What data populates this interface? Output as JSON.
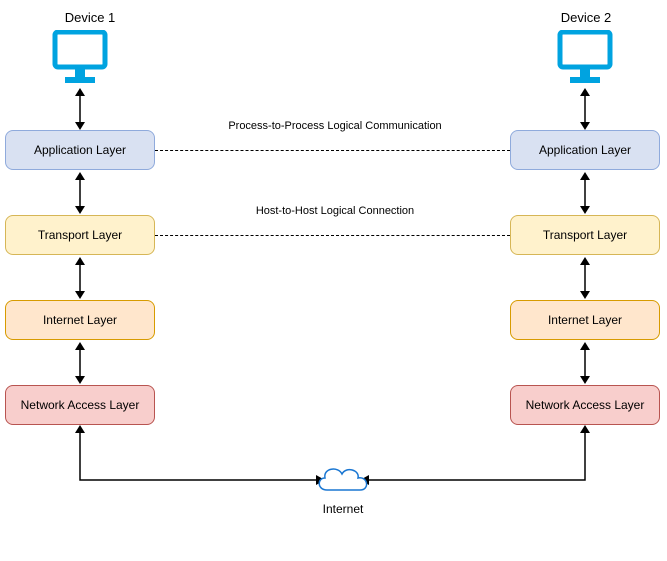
{
  "device1": {
    "label": "Device 1"
  },
  "device2": {
    "label": "Device 2"
  },
  "layers": {
    "application": "Application Layer",
    "transport": "Transport Layer",
    "internet": "Internet Layer",
    "network": "Network Access Layer"
  },
  "connections": {
    "app_comm": "Process-to-Process Logical Communication",
    "transport_comm": "Host-to-Host Logical Connection"
  },
  "internet": {
    "label": "Internet"
  },
  "colors": {
    "monitor": "#00A3E0",
    "cloud_stroke": "#1976d2"
  }
}
